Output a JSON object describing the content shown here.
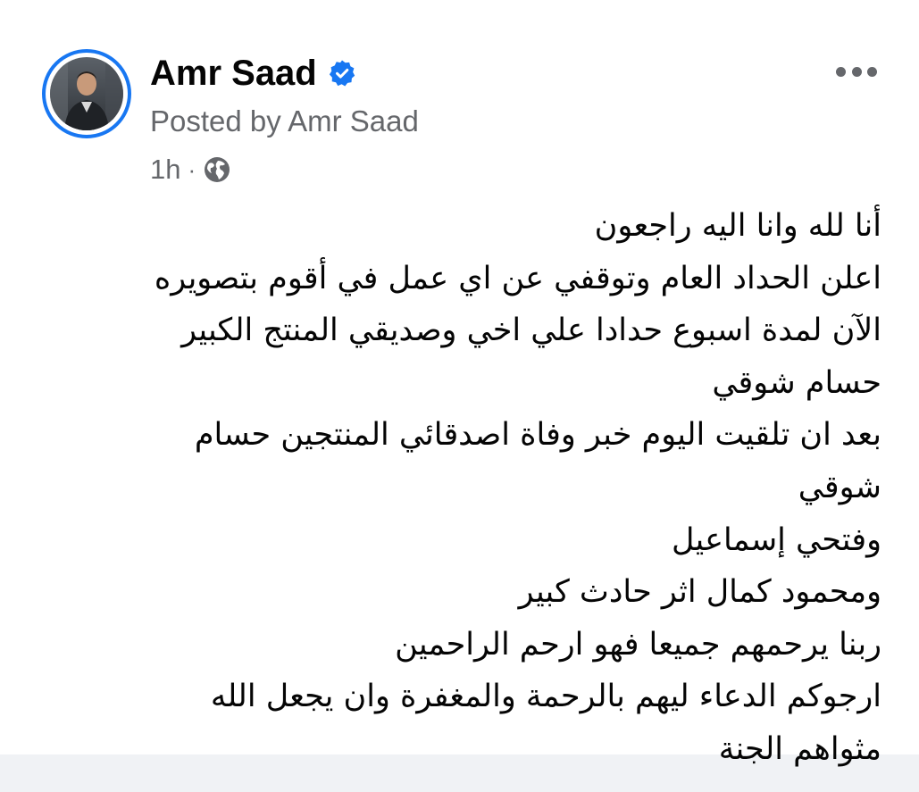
{
  "post": {
    "author": "Amr Saad",
    "posted_by": "Posted by Amr Saad",
    "time": "1h",
    "separator": "·",
    "audience_icon": "globe-icon",
    "verified_icon": "verified-badge-icon",
    "more_icon": "more-options-icon",
    "body_lines": [
      "أنا لله وانا اليه راجعون",
      "اعلن الحداد العام وتوقفي عن اي عمل في أقوم بتصويره",
      "الآن لمدة اسبوع حدادا علي اخي وصديقي المنتج الكبير",
      "حسام شوقي",
      "بعد ان تلقيت اليوم خبر وفاة اصدقائي المنتجين حسام",
      "شوقي",
      "وفتحي إسماعيل",
      "ومحمود كمال  اثر حادث كبير",
      "ربنا يرحمهم جميعا فهو ارحم الراحمين",
      "ارجوكم الدعاء ليهم بالرحمة والمغفرة وان يجعل الله",
      "مثواهم الجنة"
    ]
  },
  "colors": {
    "accent": "#1877f2",
    "text": "#050505",
    "secondary_text": "#65676b",
    "card_background": "#ffffff",
    "page_background": "#f0f2f5"
  }
}
